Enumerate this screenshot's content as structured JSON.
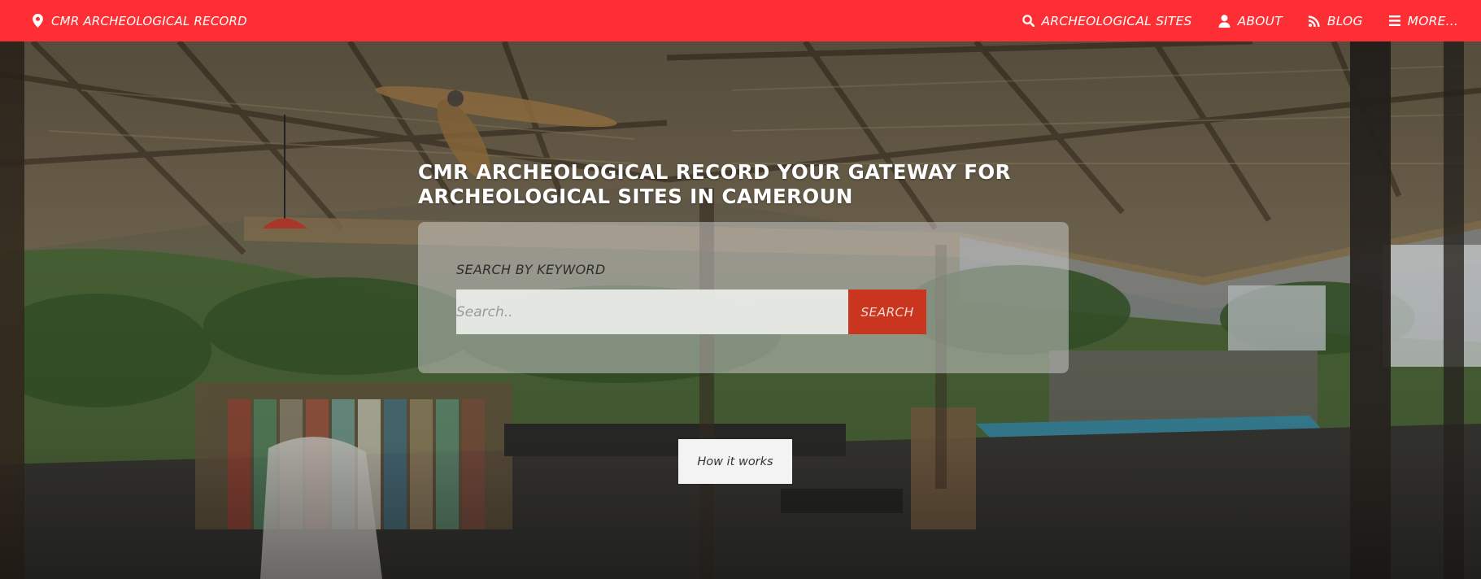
{
  "nav": {
    "brand_label": "CMR ARCHEOLOGICAL RECORD",
    "brand_icon": "map-marker-icon",
    "items": [
      {
        "label": "ARCHEOLOGICAL SITES",
        "icon": "search-icon"
      },
      {
        "label": "ABOUT",
        "icon": "user-icon"
      },
      {
        "label": "BLOG",
        "icon": "rss-icon"
      },
      {
        "label": "MORE...",
        "icon": "hamburger-menu-icon"
      }
    ]
  },
  "hero": {
    "headline": "CMR ARCHEOLOGICAL RECORD YOUR GATEWAY FOR ARCHEOLOGICAL SITES IN CAMEROUN",
    "search": {
      "label": "SEARCH BY KEYWORD",
      "placeholder": "Search..",
      "value": "",
      "button_label": "SEARCH"
    },
    "how_it_works_label": "How it works"
  },
  "colors": {
    "nav_background": "#fe2f34",
    "search_button": "#c9351e",
    "panel_overlay": "rgba(205,205,205,0.52)"
  }
}
